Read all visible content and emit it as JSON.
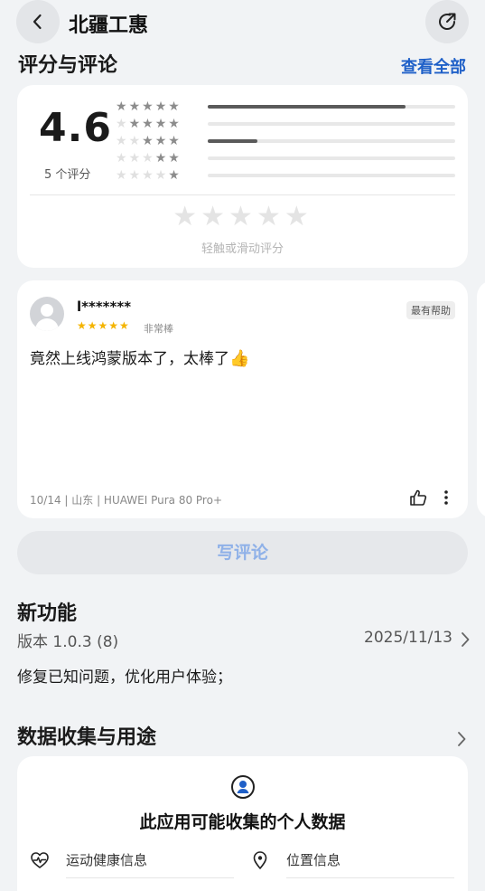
{
  "header": {
    "title": "北疆工惠",
    "back_icon": "chevron-left-icon",
    "share_icon": "share-icon"
  },
  "ratings": {
    "section_title": "评分与评论",
    "see_all": "查看全部",
    "score": "4.6",
    "count": "5 个评分",
    "distribution": [
      {
        "stars": 5,
        "fraction": 0.8
      },
      {
        "stars": 4,
        "fraction": 0
      },
      {
        "stars": 3,
        "fraction": 0.2
      },
      {
        "stars": 2,
        "fraction": 0
      },
      {
        "stars": 1,
        "fraction": 0
      }
    ],
    "tap_hint": "轻触或滑动评分"
  },
  "review": {
    "user": "l*******",
    "rating": 5,
    "rating_label": "非常棒",
    "badge": "最有帮助",
    "text": "竟然上线鸿蒙版本了，太棒了",
    "meta": "10/14 | 山东 | HUAWEI Pura 80 Pro+"
  },
  "write_review": "写评论",
  "new_features": {
    "title": "新功能",
    "version": "版本 1.0.3 (8)",
    "date": "2025/11/13",
    "notes": "修复已知问题，优化用户体验；"
  },
  "data_collection": {
    "title": "数据收集与用途",
    "card_title": "此应用可能收集的个人数据",
    "items": [
      {
        "label": "运动健康信息",
        "icon": "heart-pulse-icon"
      },
      {
        "label": "位置信息",
        "icon": "location-pin-icon"
      }
    ]
  },
  "colors": {
    "accent": "#1f60c8",
    "star": "#f4b400",
    "background": "#f1f3f5"
  }
}
